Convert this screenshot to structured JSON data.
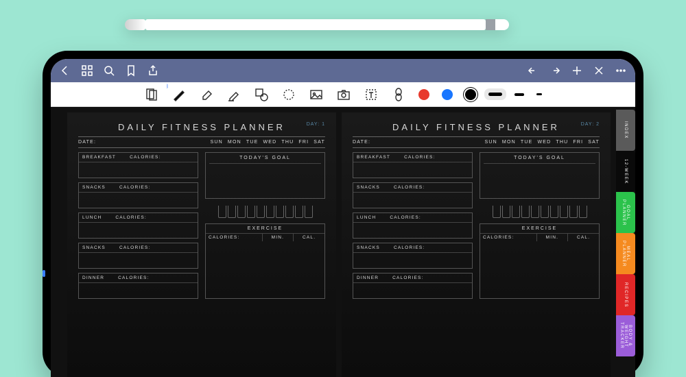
{
  "topbar": {
    "icons_left": [
      "back",
      "grid",
      "search",
      "bookmark",
      "share"
    ],
    "icons_right": [
      "undo",
      "redo",
      "plus",
      "close",
      "more"
    ]
  },
  "toolbar": {
    "tools": [
      "page-nav",
      "pen",
      "eraser",
      "highlighter",
      "shape",
      "lasso",
      "image",
      "camera",
      "text",
      "link"
    ],
    "swatches": {
      "red": "#e83b2e",
      "blue": "#1976ff",
      "black": "#000000"
    },
    "thicknesses": [
      "t1",
      "t2",
      "t3"
    ],
    "bluetooth_indicator": "⧓"
  },
  "planner": {
    "title": "DAILY FITNESS PLANNER",
    "date_label": "DATE:",
    "weekdays": [
      "SUN",
      "MON",
      "TUE",
      "WED",
      "THU",
      "FRI",
      "SAT"
    ],
    "meals": {
      "breakfast": "BREAKFAST",
      "snacks": "SNACKS",
      "lunch": "LUNCH",
      "dinner": "DINNER",
      "calories_label": "CALORIES:"
    },
    "goal_label": "TODAY'S GOAL",
    "exercise": {
      "title": "EXERCISE",
      "cal": "CALORIES:",
      "min": "MIN.",
      "cal2": "CAL."
    },
    "water_glasses": 10,
    "pages": [
      {
        "day_prefix": "DAY:",
        "day": "1"
      },
      {
        "day_prefix": "DAY:",
        "day": "2"
      }
    ]
  },
  "tabs": [
    {
      "id": "index",
      "label": "INDEX"
    },
    {
      "id": "week12",
      "label": "12-WEEK"
    },
    {
      "id": "goal-p",
      "label": "GOAL PLANNER"
    },
    {
      "id": "meal-p",
      "label": "MEAL PLANNER"
    },
    {
      "id": "recipes",
      "label": "RECIPES"
    },
    {
      "id": "tracker",
      "label": "BODY & WEIGHT TRACKER"
    }
  ]
}
